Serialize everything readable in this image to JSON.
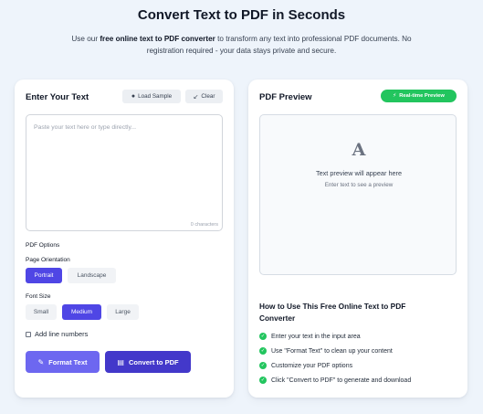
{
  "hero": {
    "title": "Convert Text to PDF in Seconds",
    "subtitle_pre": "Use our ",
    "subtitle_bold": "free online text to PDF converter",
    "subtitle_post": " to transform any text into professional PDF documents. No registration required - your data stays private and secure."
  },
  "editor": {
    "title": "Enter Your Text",
    "load_sample": "Load Sample",
    "clear": "Clear",
    "placeholder": "Paste your text here or type directly...",
    "char_count": "0 characters",
    "options_label": "PDF Options",
    "orientation_label": "Page Orientation",
    "orientation_options": [
      "Portrait",
      "Landscape"
    ],
    "orientation_selected": "Portrait",
    "font_size_label": "Font Size",
    "font_size_options": [
      "Small",
      "Medium",
      "Large"
    ],
    "font_size_selected": "Medium",
    "line_numbers_label": "Add line numbers",
    "line_numbers_checked": false,
    "format_button": "Format Text",
    "convert_button": "Convert to PDF"
  },
  "preview": {
    "title": "PDF Preview",
    "badge": "Real-time Preview",
    "icon_letter": "A",
    "empty_text": "Text preview will appear here",
    "empty_sub": "Enter text to see a preview",
    "howto_title": "How to Use This Free Online Text to PDF Converter",
    "steps": [
      "Enter your text in the input area",
      "Use \"Format Text\" to clean up your content",
      "Customize your PDF options",
      "Click \"Convert to PDF\" to generate and download"
    ]
  },
  "colors": {
    "accent": "#4f46e5",
    "success": "#22c55e",
    "background": "#eef4fb"
  },
  "icons": {
    "load_sample": "lightbulb-icon",
    "clear": "broom-icon",
    "badge": "lightning-icon",
    "format": "pencil-icon",
    "convert": "document-icon",
    "step": "check-circle-icon"
  }
}
